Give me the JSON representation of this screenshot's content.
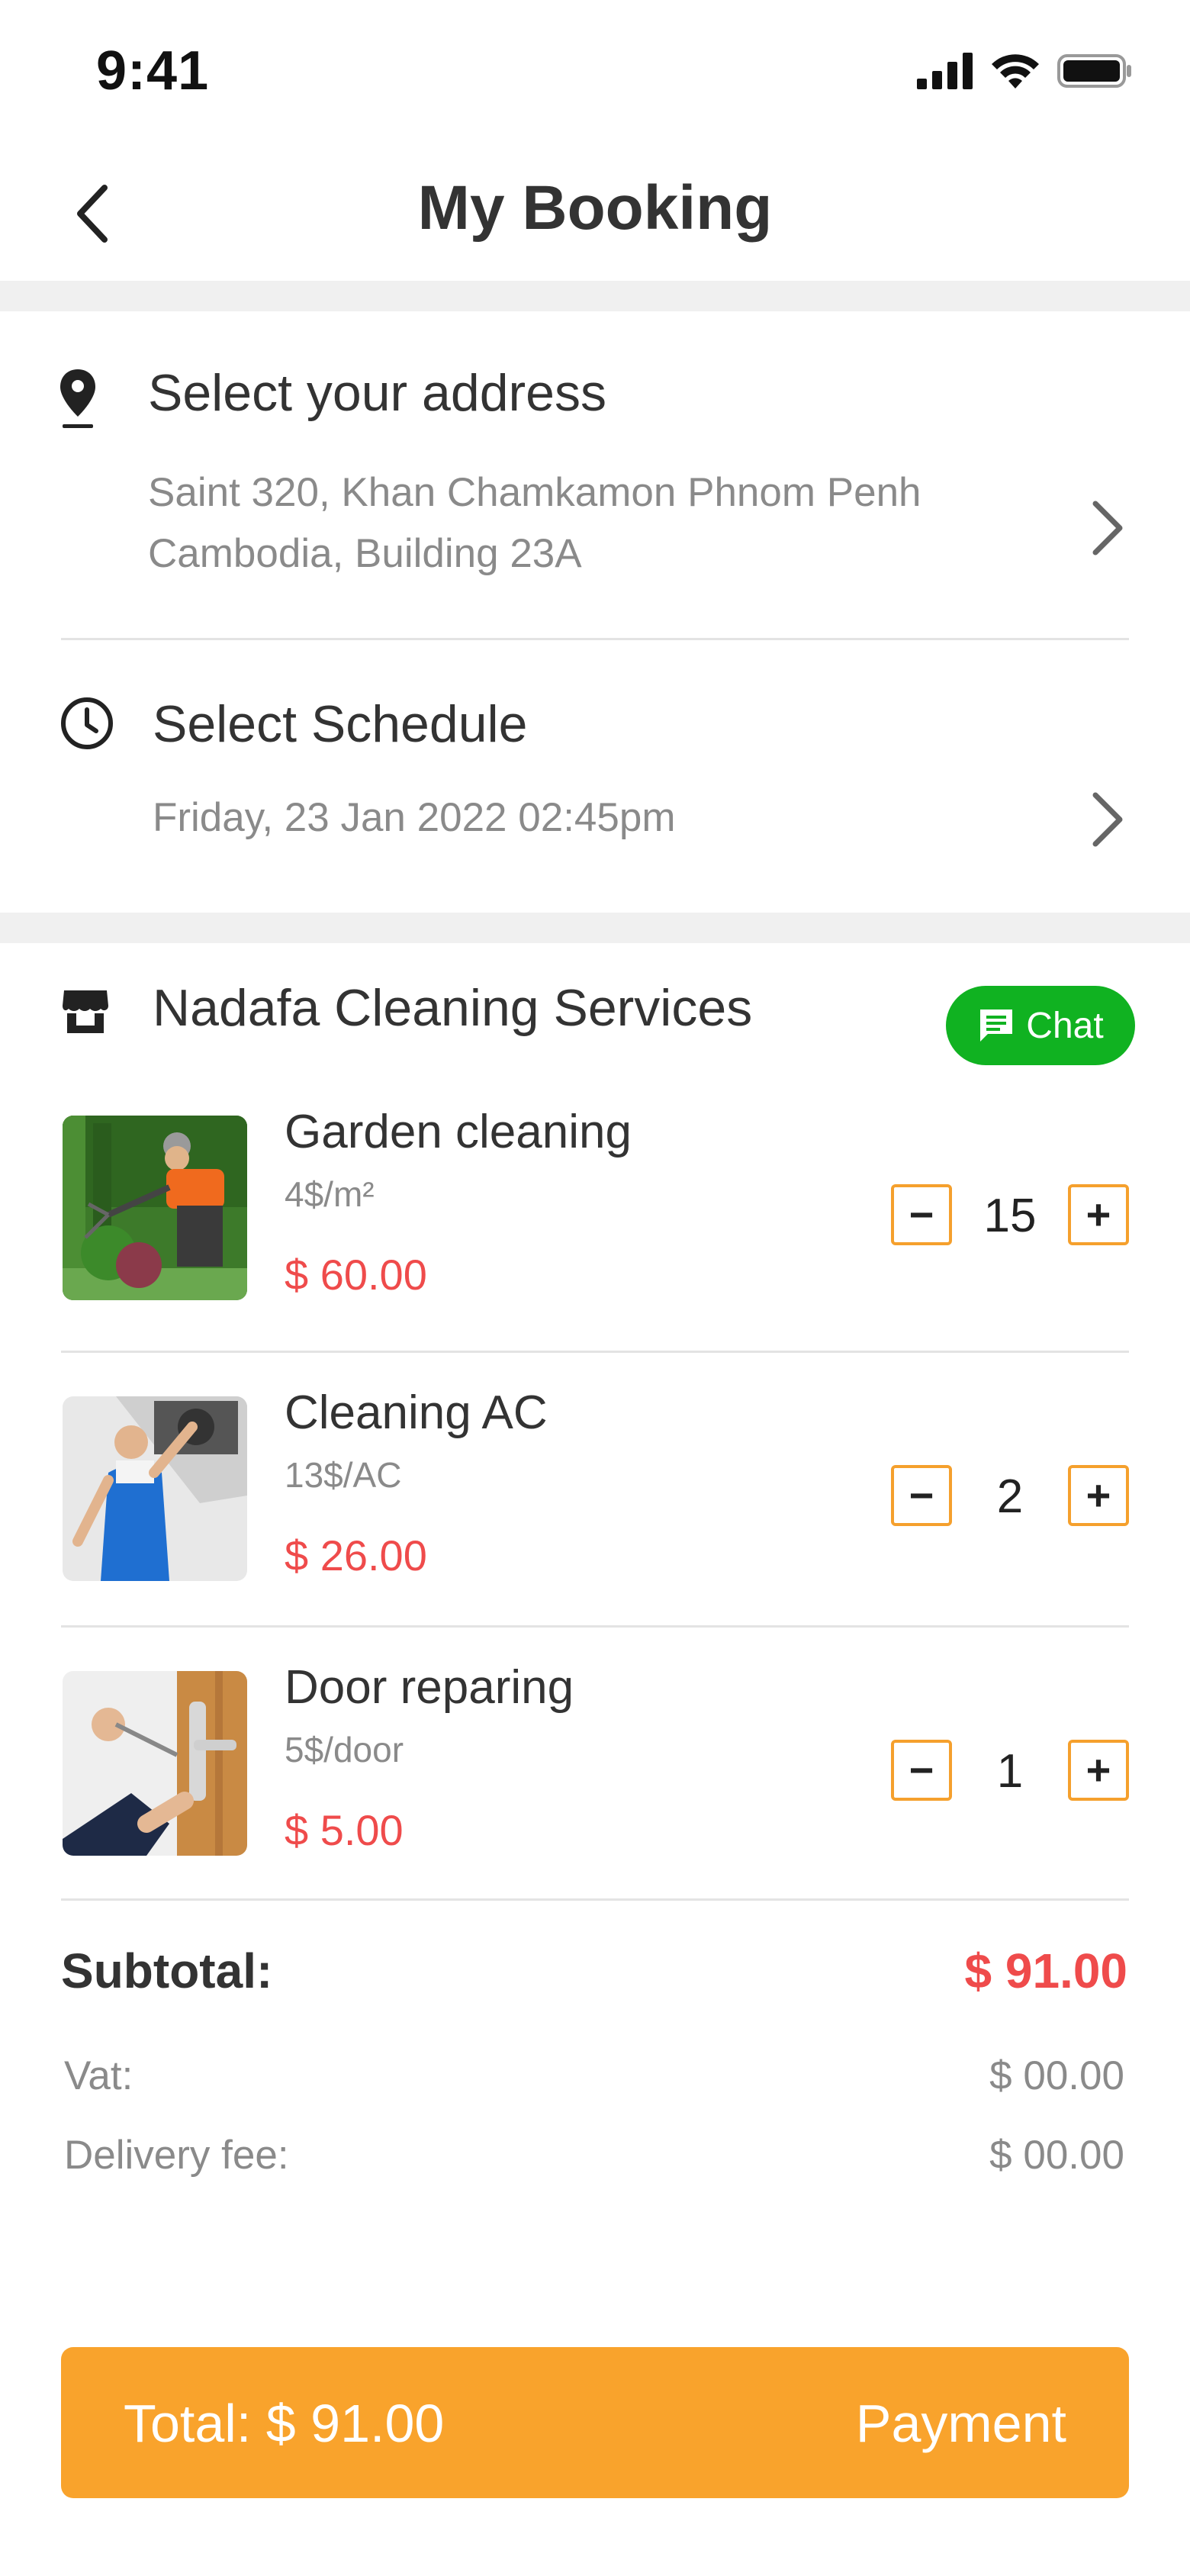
{
  "status_bar": {
    "time": "9:41"
  },
  "header": {
    "title": "My Booking"
  },
  "address": {
    "title": "Select your address",
    "line1": "Saint 320, Khan Chamkamon Phnom Penh",
    "line2": "Cambodia, Building 23A"
  },
  "schedule": {
    "title": "Select Schedule",
    "value": "Friday, 23 Jan 2022  02:45pm"
  },
  "provider": {
    "name": "Nadafa Cleaning Services",
    "chat_label": "Chat"
  },
  "items": [
    {
      "name": "Garden cleaning",
      "rate": "4$/m²",
      "price": "$ 60.00",
      "qty": "15"
    },
    {
      "name": "Cleaning AC",
      "rate": "13$/AC",
      "price": "$ 26.00",
      "qty": "2"
    },
    {
      "name": "Door reparing",
      "rate": "5$/door",
      "price": "$ 5.00",
      "qty": "1"
    }
  ],
  "qty_controls": {
    "minus": "−",
    "plus": "+"
  },
  "totals": {
    "subtotal_label": "Subtotal:",
    "subtotal_value": "$ 91.00",
    "vat_label": "Vat:",
    "vat_value": "$ 00.00",
    "delivery_label": "Delivery fee:",
    "delivery_value": "$ 00.00"
  },
  "footer": {
    "total": "Total: $ 91.00",
    "payment_label": "Payment"
  },
  "colors": {
    "accent": "#f9a32c",
    "price": "#ef4b4b",
    "chat": "#10b221"
  }
}
